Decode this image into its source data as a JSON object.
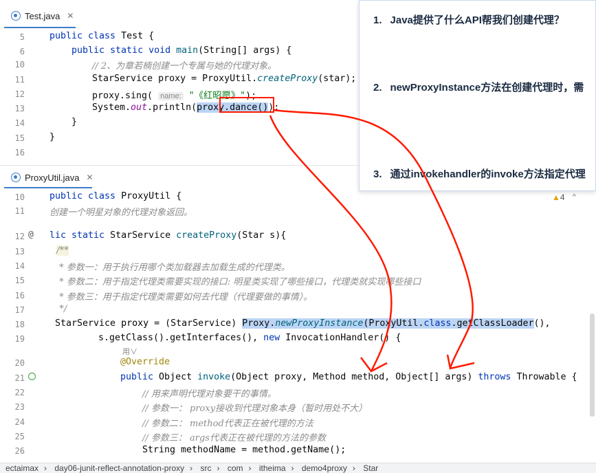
{
  "tabs": {
    "top": "Test.java",
    "bottom": "ProxyUtil.java"
  },
  "editor_top": {
    "line_numbers": [
      "5",
      "6",
      "10",
      "11",
      "12",
      "13",
      "14",
      "15",
      "16"
    ],
    "comment_line": "// 2、为章若楠创建一个专属与她的代理对象。",
    "hint_name": "name:",
    "sing_arg": "\"《红昭愿》\"",
    "tail_sing": ");"
  },
  "editor_bottom": {
    "line_numbers": [
      "10",
      "11",
      "12",
      "13",
      "14",
      "15",
      "16",
      "17",
      "18",
      "19",
      "20",
      "21",
      "22",
      "23",
      "24",
      "25",
      "26"
    ],
    "comment_11": "创建一个明星对象的代理对象返回。",
    "javadoc_open": "/**",
    "javadoc_14": " * 参数一：用于执行用哪个类加载器去加载生成的代理类。",
    "javadoc_15": " * 参数二：用于指定代理类需要实现的接口: 明星类实现了哪些接口，代理类就实现哪些接口",
    "javadoc_16": " * 参数三：用于指定代理类需要如何去代理（代理要做的事情）。",
    "javadoc_close": " */",
    "override": "@Override",
    "comment_22": "// 用来声明代理对象要干的事情。",
    "comment_23": "// 参数一： proxy接收到代理对象本身（暂时用处不大）",
    "comment_24": "// 参数二： method代表正在被代理的方法",
    "comment_25": "// 参数三： args代表正在被代理的方法的参数",
    "warning_count": "4",
    "usage_hint": "用∨"
  },
  "popup": {
    "q1_num": "1.",
    "q1": "Java提供了什么API帮我们创建代理？",
    "q2_num": "2.",
    "q2": "newProxyInstance方法在创建代理时，需",
    "q3_num": "3.",
    "q3": "通过invokehandler的invoke方法指定代理"
  },
  "breadcrumb": [
    "ectaimax",
    "day06-junit-reflect-annotation-proxy",
    "src",
    "com",
    "itheima",
    "demo4proxy",
    "Star"
  ],
  "colors": {
    "accent": "#3d7cc9",
    "annotation_red": "#ff1a00",
    "selection": "#bcd5f5"
  }
}
